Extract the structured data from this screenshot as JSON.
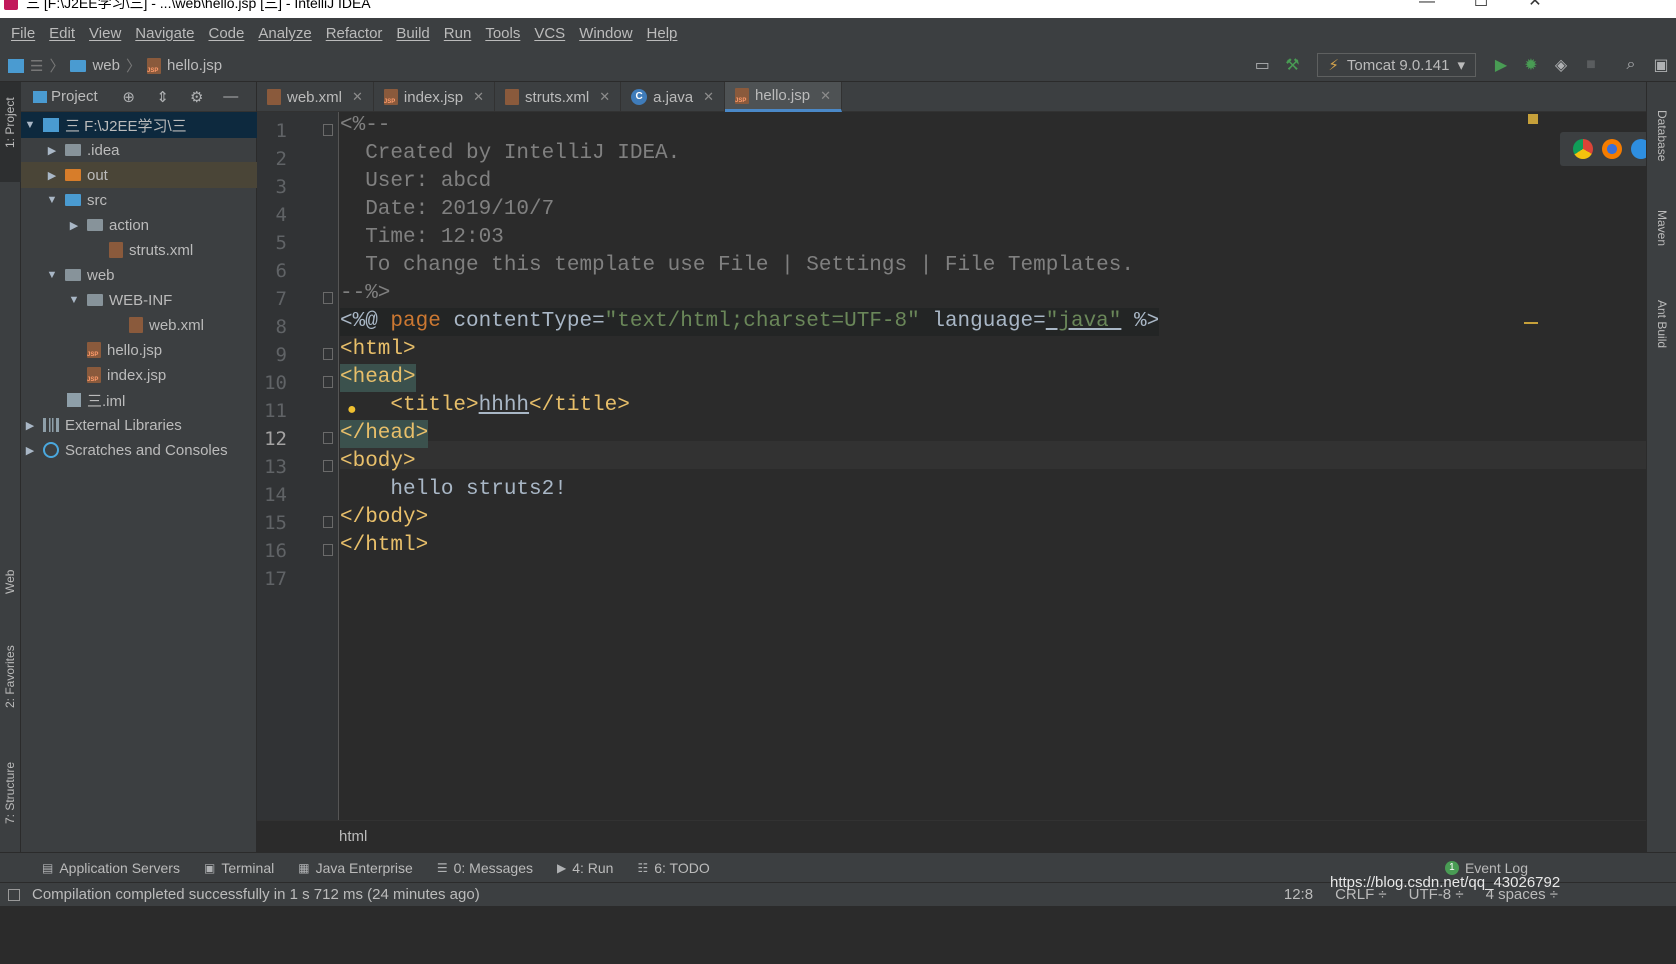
{
  "window": {
    "title": "三 [F:\\J2EE学习\\三] - ...\\web\\hello.jsp [三] - IntelliJ IDEA",
    "controls": {
      "minimize": "—",
      "maximize": "☐",
      "close": "✕"
    }
  },
  "menu": [
    "File",
    "Edit",
    "View",
    "Navigate",
    "Code",
    "Analyze",
    "Refactor",
    "Build",
    "Run",
    "Tools",
    "VCS",
    "Window",
    "Help"
  ],
  "breadcrumbs": {
    "folder": "web",
    "file": "hello.jsp"
  },
  "run_config": {
    "label": "Tomcat 9.0.141"
  },
  "project_panel": {
    "title": "Project",
    "items": [
      {
        "label": "三  F:\\J2EE学习\\三",
        "icon": "project-folder-icon"
      },
      {
        "label": ".idea",
        "icon": "folder-icon"
      },
      {
        "label": "out",
        "icon": "excluded-folder-icon"
      },
      {
        "label": "src",
        "icon": "source-folder-icon"
      },
      {
        "label": "action",
        "icon": "package-icon"
      },
      {
        "label": "struts.xml",
        "icon": "xml-file-icon"
      },
      {
        "label": "web",
        "icon": "web-folder-icon"
      },
      {
        "label": "WEB-INF",
        "icon": "folder-icon"
      },
      {
        "label": "web.xml",
        "icon": "xml-file-icon"
      },
      {
        "label": "hello.jsp",
        "icon": "jsp-file-icon"
      },
      {
        "label": "index.jsp",
        "icon": "jsp-file-icon"
      },
      {
        "label": "三.iml",
        "icon": "iml-file-icon"
      },
      {
        "label": "External Libraries",
        "icon": "libraries-icon"
      },
      {
        "label": "Scratches and Consoles",
        "icon": "scratches-icon"
      }
    ]
  },
  "tabs": [
    {
      "label": "web.xml",
      "icon": "xml-file-icon"
    },
    {
      "label": "index.jsp",
      "icon": "jsp-file-icon"
    },
    {
      "label": "struts.xml",
      "icon": "xml-file-icon"
    },
    {
      "label": "a.java",
      "icon": "java-class-icon"
    },
    {
      "label": "hello.jsp",
      "icon": "jsp-file-icon",
      "active": true
    }
  ],
  "editor": {
    "line_numbers": [
      "1",
      "2",
      "3",
      "4",
      "5",
      "6",
      "7",
      "8",
      "9",
      "10",
      "11",
      "12",
      "13",
      "14",
      "15",
      "16",
      "17"
    ],
    "current_line": "12",
    "code": {
      "l1": "<%--",
      "l2": "  Created by IntelliJ IDEA.",
      "l3": "  User: abcd",
      "l4": "  Date: 2019/10/7",
      "l5": "  Time: 12:03",
      "l6": "  To change this template use File | Settings | File Templates.",
      "l7": "--%>",
      "l8_open": "<%@ ",
      "l8_kw": "page",
      "l8_attr1": " contentType=",
      "l8_val1": "\"text/html;charset=UTF-8\"",
      "l8_attr2": " language=",
      "l8_val2": "\"java\"",
      "l8_close": " %>",
      "l9": "<html>",
      "l10": "<head>",
      "l11_open": "    <title>",
      "l11_text": "hhhh",
      "l11_close": "</title>",
      "l12": "</head>",
      "l13": "<body>",
      "l14": "    hello struts2!",
      "l15": "</body>",
      "l16": "</html>"
    },
    "breadcrumb": "html",
    "browsers": [
      "chrome-icon",
      "firefox-icon",
      "safari-icon",
      "opera-icon",
      "ie-icon",
      "edge-icon"
    ]
  },
  "left_strip": {
    "project": "1: Project",
    "web": "Web",
    "favorites": "2: Favorites",
    "structure": "7: Structure"
  },
  "right_strip": {
    "database": "Database",
    "maven": "Maven",
    "ant": "Ant Build"
  },
  "bottom_tools": [
    {
      "label": "Application Servers",
      "icon": "servers-icon"
    },
    {
      "label": "Terminal",
      "icon": "terminal-icon"
    },
    {
      "label": "Java Enterprise",
      "icon": "java-enterprise-icon"
    },
    {
      "label": "0: Messages",
      "icon": "messages-icon"
    },
    {
      "label": "4: Run",
      "icon": "run-icon"
    },
    {
      "label": "6: TODO",
      "icon": "todo-icon"
    }
  ],
  "event_log": {
    "label": "Event Log",
    "count": "1"
  },
  "status": {
    "message": "Compilation completed successfully in 1 s 712 ms (24 minutes ago)",
    "position": "12:8",
    "line_sep": "CRLF ÷",
    "encoding": "UTF-8 ÷",
    "indent": "4 spaces ÷"
  },
  "watermark": "https://blog.csdn.net/qq_43026792",
  "colors": {
    "accent": "#4a88c7",
    "tag": "#e8bf6a",
    "string": "#6a8759",
    "keyword": "#cc7832",
    "comment": "#808080"
  }
}
